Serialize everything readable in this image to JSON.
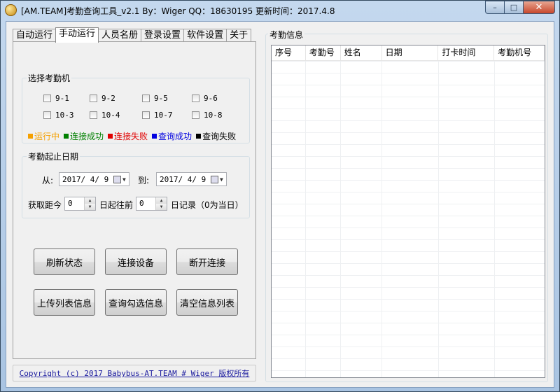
{
  "window": {
    "title": "[AM.TEAM]考勤查询工具_v2.1  By：Wiger QQ：18630195  更新时间：2017.4.8",
    "minimize_symbol": "–",
    "maximize_symbol": "□",
    "close_symbol": "✕"
  },
  "tabs": [
    {
      "label": "自动运行",
      "active": false
    },
    {
      "label": "手动运行",
      "active": true
    },
    {
      "label": "人员名册",
      "active": false
    },
    {
      "label": "登录设置",
      "active": false
    },
    {
      "label": "软件设置",
      "active": false
    },
    {
      "label": "关于",
      "active": false
    }
  ],
  "machine_group": {
    "title": "选择考勤机",
    "machines": [
      {
        "label": "9-1",
        "checked": false
      },
      {
        "label": "9-2",
        "checked": false
      },
      {
        "label": "9-5",
        "checked": false
      },
      {
        "label": "9-6",
        "checked": false
      },
      {
        "label": "10-3",
        "checked": false
      },
      {
        "label": "10-4",
        "checked": false
      },
      {
        "label": "10-7",
        "checked": false
      },
      {
        "label": "10-8",
        "checked": false
      }
    ],
    "legend": [
      {
        "label": "运行中",
        "color": "#f5a000"
      },
      {
        "label": "连接成功",
        "color": "#008000"
      },
      {
        "label": "连接失败",
        "color": "#e00000"
      },
      {
        "label": "查询成功",
        "color": "#0000e0"
      },
      {
        "label": "查询失败",
        "color": "#000000"
      }
    ]
  },
  "date_group": {
    "title": "考勤起止日期",
    "from_label": "从:",
    "from_value": "2017/ 4/ 9",
    "to_label": "到:",
    "to_value": "2017/ 4/ 9",
    "fetch_label": "获取距今",
    "days_before_value": "0",
    "days_before_label": "日起往前",
    "days_records_value": "0",
    "days_records_label": "日记录（0为当日）"
  },
  "buttons": {
    "refresh": "刷新状态",
    "connect": "连接设备",
    "disconnect": "断开连接",
    "upload": "上传列表信息",
    "query": "查询勾选信息",
    "clear": "清空信息列表"
  },
  "footer": {
    "copyright": "Copyright (c) 2017 Babybus-AT.TEAM # Wiger 版权所有"
  },
  "info": {
    "title": "考勤信息",
    "columns": [
      "序号",
      "考勤号",
      "姓名",
      "日期",
      "打卡时间",
      "考勤机号"
    ],
    "rows": []
  }
}
